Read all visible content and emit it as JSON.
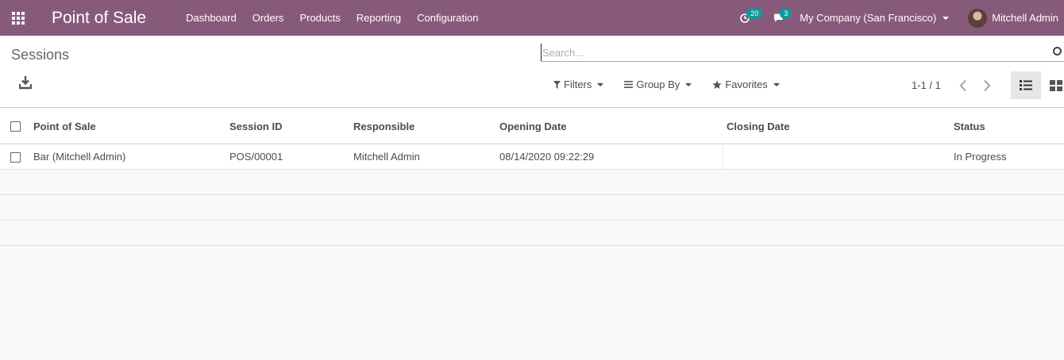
{
  "navbar": {
    "app_title": "Point of Sale",
    "menu": [
      "Dashboard",
      "Orders",
      "Products",
      "Reporting",
      "Configuration"
    ],
    "activity_count": "20",
    "message_count": "3",
    "company": "My Company (San Francisco)",
    "user": "Mitchell Admin"
  },
  "control_panel": {
    "breadcrumb": "Sessions",
    "search_placeholder": "Search...",
    "filters_label": "Filters",
    "groupby_label": "Group By",
    "favorites_label": "Favorites",
    "pager": "1-1 / 1"
  },
  "table": {
    "columns": [
      "Point of Sale",
      "Session ID",
      "Responsible",
      "Opening Date",
      "Closing Date",
      "Status"
    ],
    "rows": [
      [
        "Bar (Mitchell Admin)",
        "POS/00001",
        "Mitchell Admin",
        "08/14/2020 09:22:29",
        "",
        "In Progress"
      ]
    ]
  },
  "colors": {
    "brand": "#875a7b",
    "badge": "#00a09d"
  }
}
